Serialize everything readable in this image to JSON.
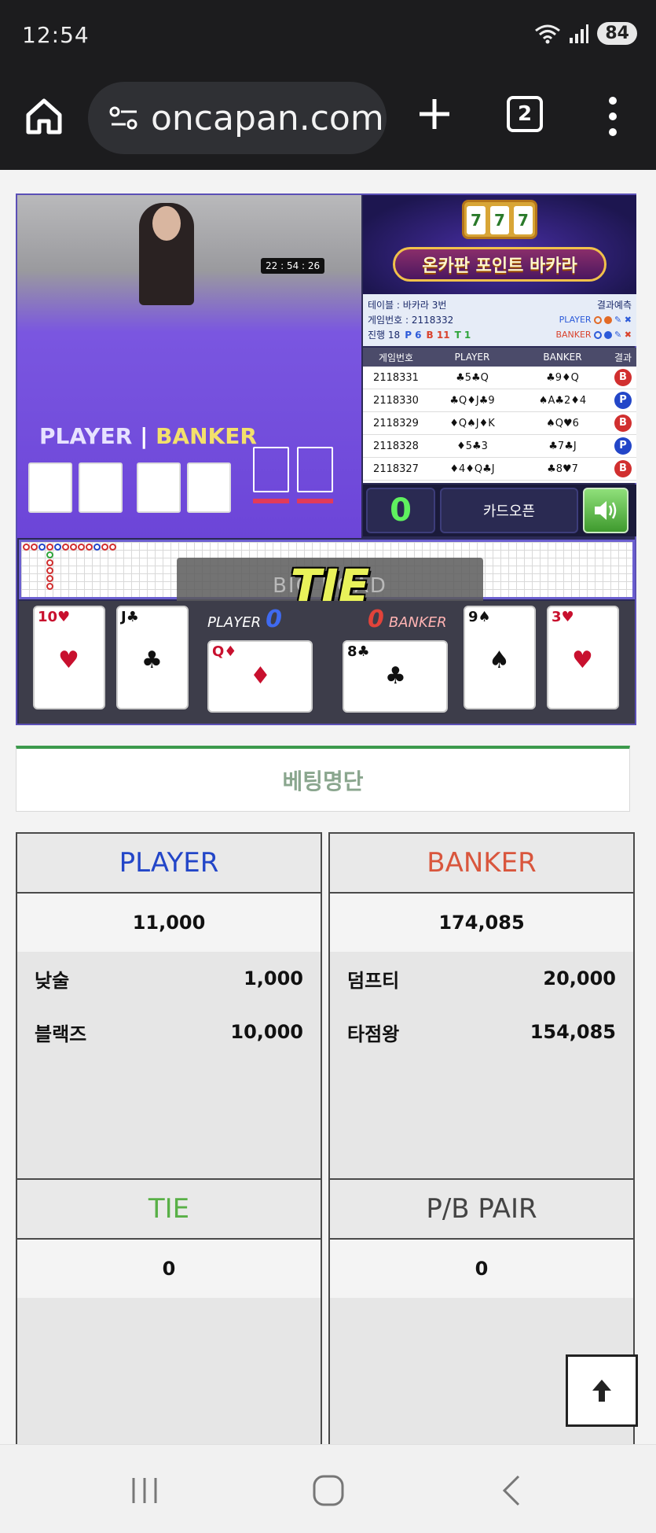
{
  "status": {
    "time": "12:54",
    "battery": "84"
  },
  "browser": {
    "url": "oncapan.com",
    "tab_count": "2"
  },
  "game": {
    "video": {
      "timer": "22 : 54 : 26",
      "player_word": "PLAYER",
      "banker_word": "BANKER"
    },
    "promo": {
      "title": "온카판 포인트 바카라",
      "slot_symbols": [
        "7",
        "7",
        "7"
      ]
    },
    "info": {
      "table": "테이블 : 바카라 3번",
      "prediction_label": "결과예측",
      "game_no": "게임번호 : 2118332",
      "progress_label": "진행",
      "progress": "18",
      "p_count": "P 6",
      "b_count": "B 11",
      "t_count": "T 1",
      "pred_player": "PLAYER",
      "pred_banker": "BANKER"
    },
    "history": {
      "headers": [
        "게임번호",
        "PLAYER",
        "BANKER",
        "결과"
      ],
      "rows": [
        {
          "no": "2118331",
          "player": "♣5♣Q",
          "banker": "♣9♦Q",
          "result": "B"
        },
        {
          "no": "2118330",
          "player": "♣Q♦J♣9",
          "banker": "♠A♣2♦4",
          "result": "P"
        },
        {
          "no": "2118329",
          "player": "♦Q♠J♦K",
          "banker": "♠Q♥6",
          "result": "B"
        },
        {
          "no": "2118328",
          "player": "♦5♣3",
          "banker": "♣7♣J",
          "result": "P"
        },
        {
          "no": "2118327",
          "player": "♦4♦Q♣J",
          "banker": "♣8♥7",
          "result": "B"
        }
      ]
    },
    "controls": {
      "count": "0",
      "card_open": "카드오픈"
    },
    "result": {
      "ghost": "BIG ROAD",
      "tie": "TIE"
    },
    "cards": {
      "player_label": "PLAYER",
      "player_score": "0",
      "banker_label": "BANKER",
      "banker_score": "0",
      "player_cards": [
        "10♥",
        "J♣",
        "Q♦"
      ],
      "banker_cards": [
        "8♣",
        "9♠",
        "3♥"
      ]
    }
  },
  "betting": {
    "title": "베팅명단",
    "player": {
      "label": "PLAYER",
      "total": "11,000",
      "entries": [
        {
          "name": "낮술",
          "amount": "1,000"
        },
        {
          "name": "블랙즈",
          "amount": "10,000"
        }
      ]
    },
    "banker": {
      "label": "BANKER",
      "total": "174,085",
      "entries": [
        {
          "name": "덤프티",
          "amount": "20,000"
        },
        {
          "name": "타점왕",
          "amount": "154,085"
        }
      ]
    },
    "tie": {
      "label": "TIE",
      "total": "0"
    },
    "pair": {
      "label": "P/B PAIR",
      "total": "0"
    }
  },
  "colors": {
    "player": "#2346c8",
    "banker": "#d9563d",
    "tie": "#59b047",
    "accent_green": "#3c9a4c"
  }
}
